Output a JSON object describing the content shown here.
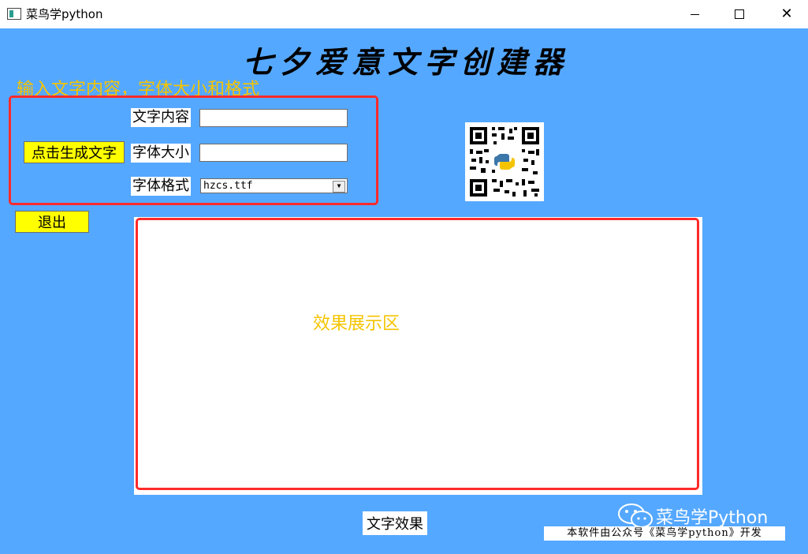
{
  "window": {
    "title": "菜鸟学python"
  },
  "header": {
    "title": "七夕爱意文字创建器"
  },
  "annotations": {
    "input_hint": "输入文字内容，字体大小和格式",
    "display_hint": "效果展示区"
  },
  "form": {
    "text_content_label": "文字内容",
    "text_content_value": "",
    "font_size_label": "字体大小",
    "font_size_value": "",
    "font_format_label": "字体格式",
    "font_format_value": "hzcs.ttf",
    "generate_button": "点击生成文字"
  },
  "exit_button": "退出",
  "effect_label": "文字效果",
  "watermark": "菜鸟学Python",
  "footer": "本软件由公众号《菜鸟学python》开发",
  "colors": {
    "background": "#55a8ff",
    "button": "#ffff00",
    "annotation": "#f5c400",
    "frame": "#ff2a2a"
  },
  "icons": [
    "app-window-icon",
    "minimize-icon",
    "maximize-icon",
    "close-icon",
    "qr-code-icon",
    "python-logo-icon",
    "wechat-icon",
    "dropdown-arrow-icon"
  ]
}
